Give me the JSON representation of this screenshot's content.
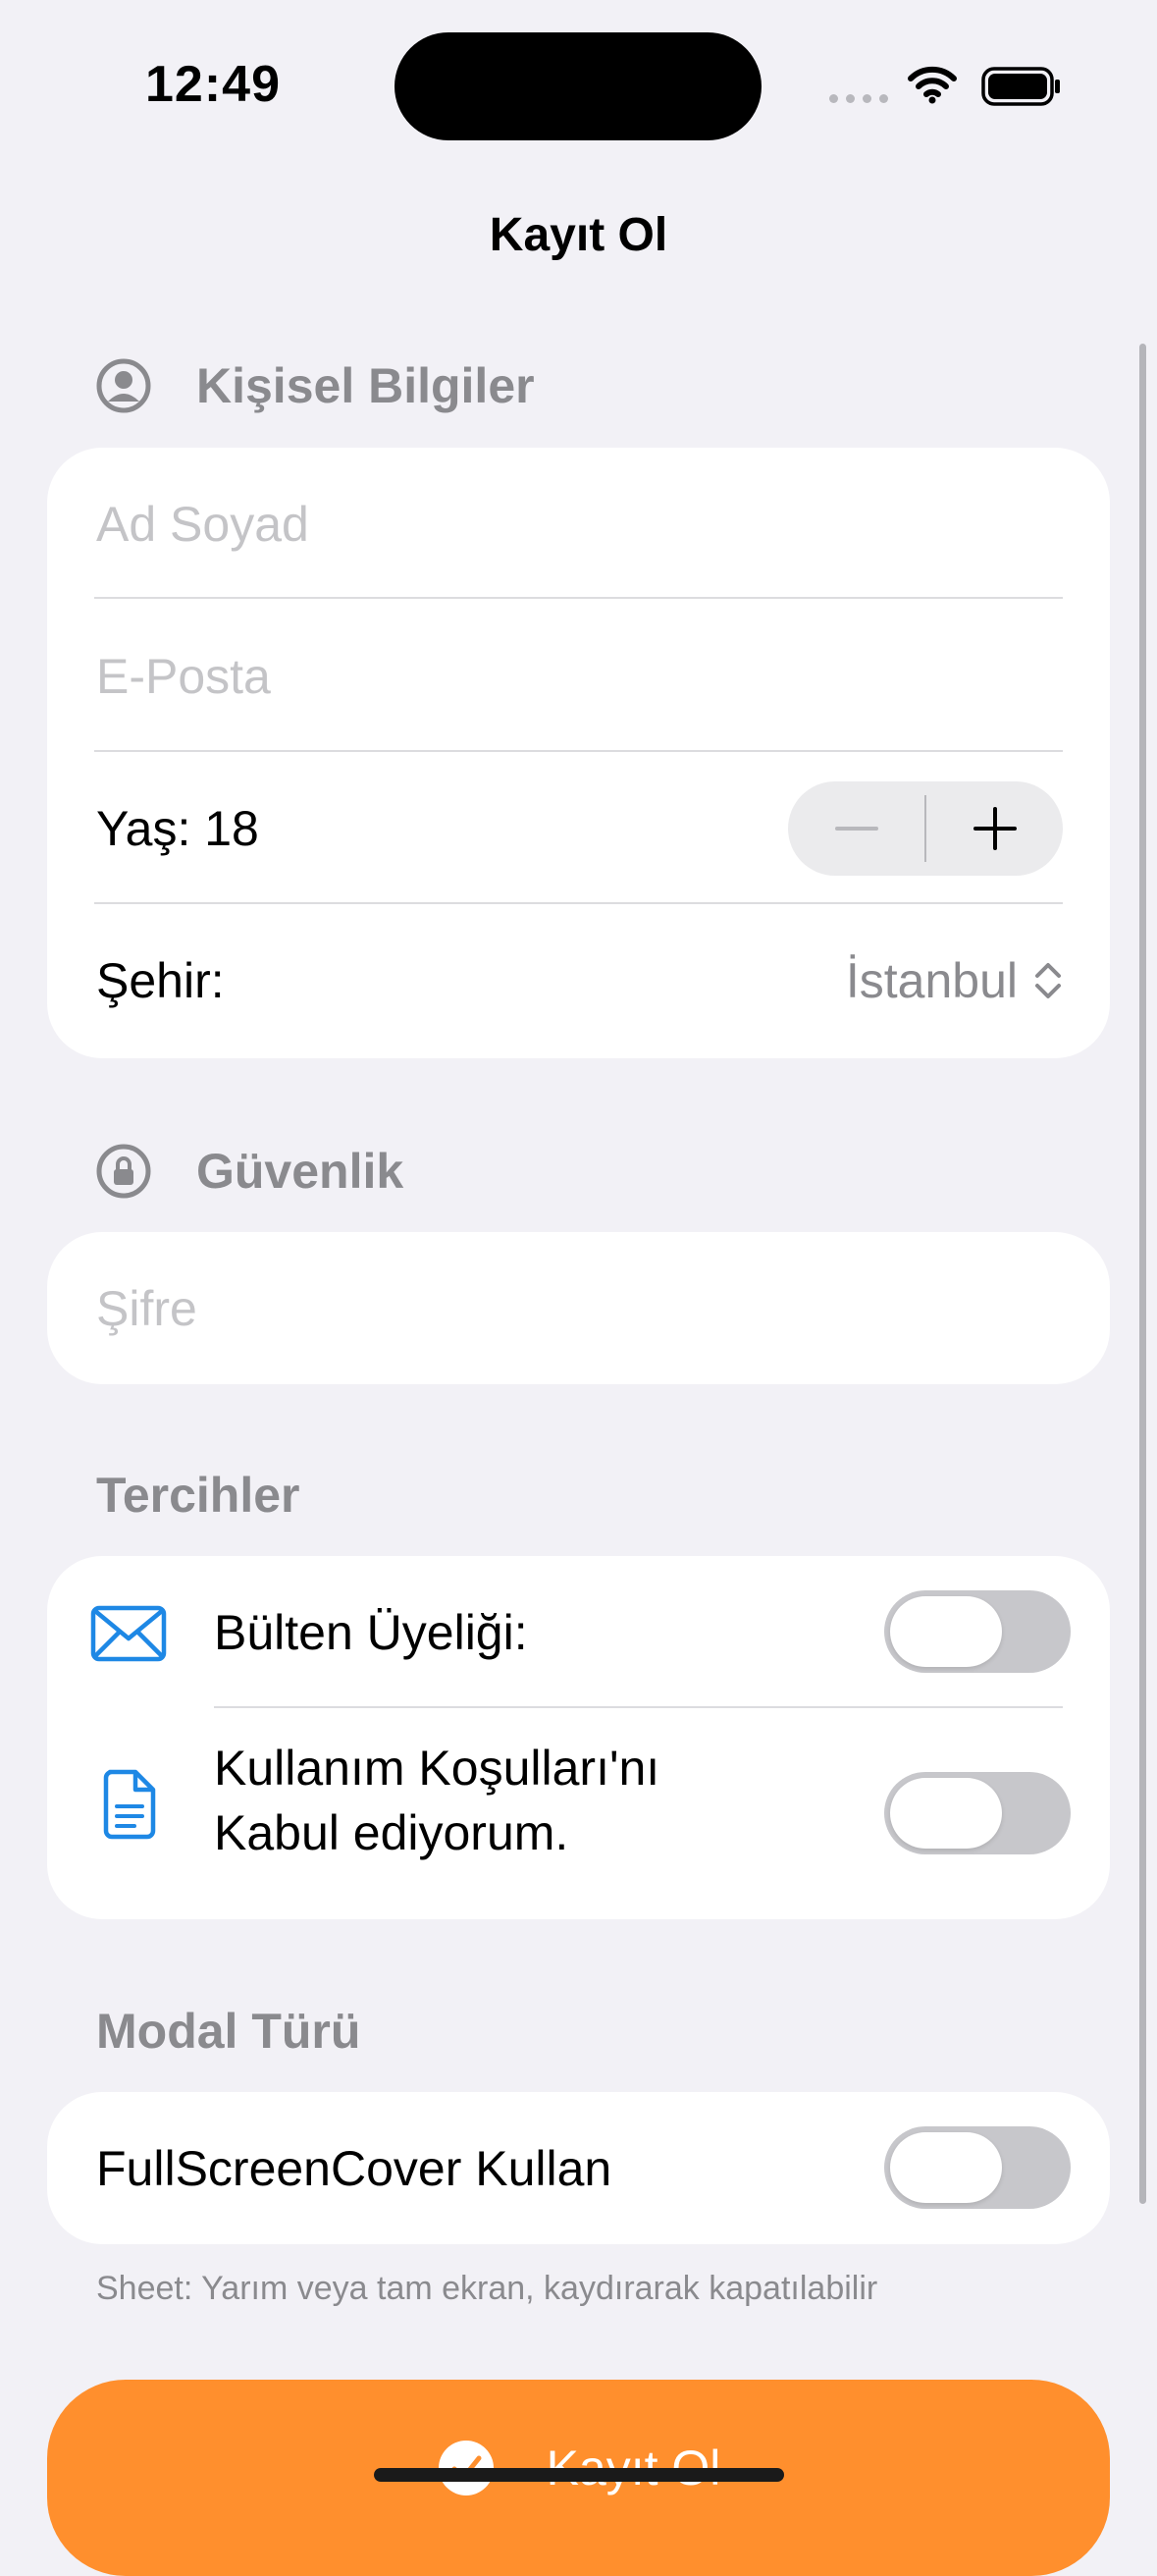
{
  "status_bar": {
    "time": "12:49"
  },
  "nav": {
    "title": "Kayıt Ol"
  },
  "personal": {
    "header": "Kişisel Bilgiler",
    "name_placeholder": "Ad Soyad",
    "email_placeholder": "E-Posta",
    "age_label": "Yaş: 18",
    "city_label": "Şehir:",
    "city_value": "İstanbul"
  },
  "security": {
    "header": "Güvenlik",
    "password_placeholder": "Şifre"
  },
  "preferences": {
    "header": "Tercihler",
    "newsletter_label": "Bülten Üyeliği:",
    "terms_line1": "Kullanım Koşulları'nı",
    "terms_line2": "Kabul ediyorum."
  },
  "modal": {
    "header": "Modal Türü",
    "fullscreen_label": "FullScreenCover Kullan",
    "footnote": "Sheet: Yarım veya tam ekran, kaydırarak kapatılabilir"
  },
  "submit": {
    "label": "Kayıt Ol"
  },
  "colors": {
    "accent": "#FF8F2D",
    "icon_blue": "#1E88E5",
    "background": "#F2F1F6"
  },
  "icons": [
    "person-circle-icon",
    "lock-circle-icon",
    "envelope-icon",
    "document-icon",
    "checkmark-circle-icon",
    "wifi-icon",
    "battery-icon",
    "chevron-updown-icon"
  ]
}
